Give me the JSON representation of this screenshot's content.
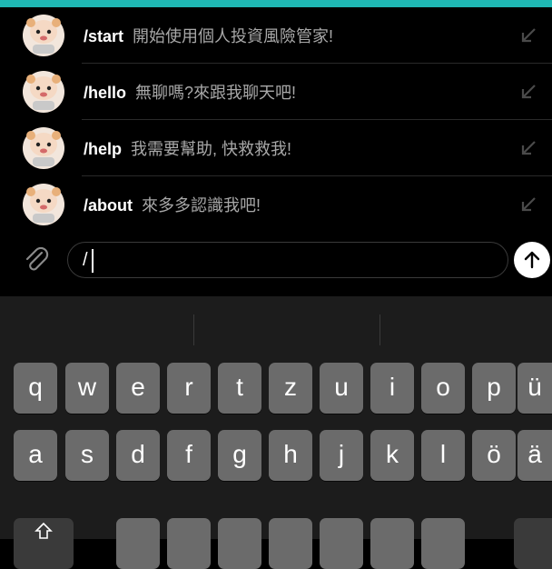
{
  "commands": [
    {
      "name": "/start",
      "desc": "開始使用個人投資風險管家!"
    },
    {
      "name": "/hello",
      "desc": "無聊嗎?來跟我聊天吧!"
    },
    {
      "name": "/help",
      "desc": "我需要幫助, 快救救我!"
    },
    {
      "name": "/about",
      "desc": "來多多認識我吧!"
    }
  ],
  "input": {
    "value": "/"
  },
  "keyboard": {
    "row1": [
      "q",
      "w",
      "e",
      "r",
      "t",
      "z",
      "u",
      "i",
      "o",
      "p",
      "ü"
    ],
    "row2": [
      "a",
      "s",
      "d",
      "f",
      "g",
      "h",
      "j",
      "k",
      "l",
      "ö",
      "ä"
    ],
    "row3": [
      "",
      "",
      "",
      "",
      "",
      "",
      "",
      "",
      ""
    ]
  },
  "icons": {
    "attach": "paperclip-icon",
    "send": "arrow-up-icon",
    "insert": "arrow-down-left-icon"
  },
  "colors": {
    "accent": "#1fb8b4",
    "background": "#000000",
    "key": "#6b6b6b"
  }
}
